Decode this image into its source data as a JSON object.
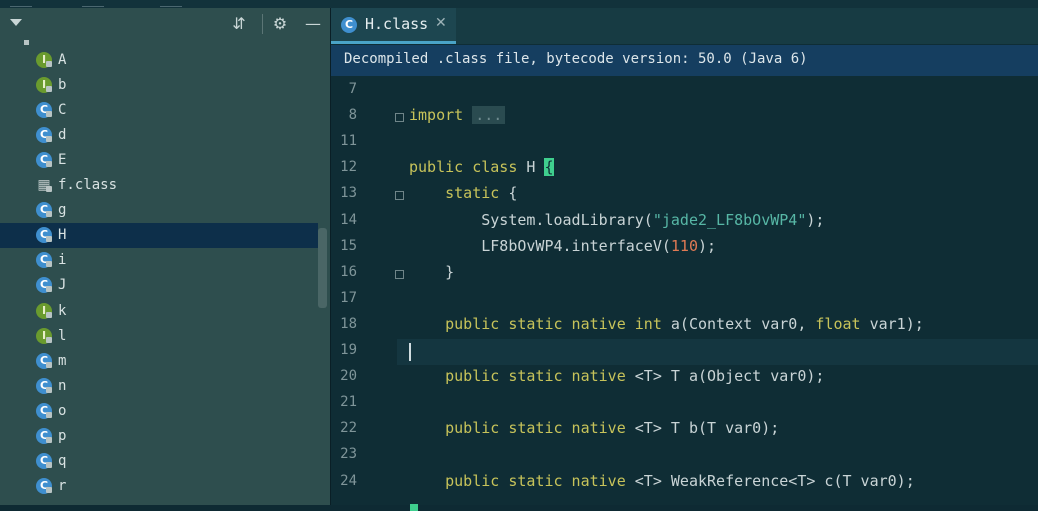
{
  "tree": {
    "items": [
      {
        "label": "A",
        "kind": "i",
        "icon": "interface-icon"
      },
      {
        "label": "b",
        "kind": "i",
        "icon": "interface-icon"
      },
      {
        "label": "C",
        "kind": "c",
        "icon": "class-icon"
      },
      {
        "label": "d",
        "kind": "c",
        "icon": "class-icon"
      },
      {
        "label": "E",
        "kind": "e",
        "icon": "enum-class-icon"
      },
      {
        "label": "f.class",
        "kind": "cls",
        "icon": "class-file-icon"
      },
      {
        "label": "g",
        "kind": "c",
        "icon": "class-icon"
      },
      {
        "label": "H",
        "kind": "c",
        "icon": "class-icon",
        "selected": true
      },
      {
        "label": "i",
        "kind": "e",
        "icon": "class-icon"
      },
      {
        "label": "J",
        "kind": "c",
        "icon": "class-icon"
      },
      {
        "label": "k",
        "kind": "i",
        "icon": "interface-icon"
      },
      {
        "label": "l",
        "kind": "i",
        "icon": "interface-icon"
      },
      {
        "label": "m",
        "kind": "c",
        "icon": "class-icon"
      },
      {
        "label": "n",
        "kind": "c",
        "icon": "class-icon"
      },
      {
        "label": "o",
        "kind": "c",
        "icon": "class-icon"
      },
      {
        "label": "p",
        "kind": "c",
        "icon": "class-icon"
      },
      {
        "label": "q",
        "kind": "c",
        "icon": "class-icon"
      },
      {
        "label": "r",
        "kind": "c",
        "icon": "class-icon"
      }
    ]
  },
  "tab": {
    "label": "H.class"
  },
  "banner": {
    "text": "Decompiled .class file, bytecode version: 50.0 (Java 6)"
  },
  "editor": {
    "current_line": "19",
    "lines": [
      {
        "n": "7",
        "segs": []
      },
      {
        "n": "8",
        "segs": [
          {
            "t": "import",
            "c": "kw"
          },
          {
            "t": " "
          },
          {
            "t": "...",
            "c": "ph"
          }
        ],
        "fold": true
      },
      {
        "n": "11",
        "segs": []
      },
      {
        "n": "12",
        "segs": [
          {
            "t": "public class",
            "c": "kw"
          },
          {
            "t": " H "
          },
          {
            "t": "{",
            "c": "brace"
          }
        ]
      },
      {
        "n": "13",
        "segs": [
          {
            "t": "    "
          },
          {
            "t": "static",
            "c": "kw"
          },
          {
            "t": " {"
          }
        ],
        "fold": true
      },
      {
        "n": "14",
        "segs": [
          {
            "t": "        System.loadLibrary("
          },
          {
            "t": "\"jade2_LF8bOvWP4\"",
            "c": "str"
          },
          {
            "t": ");"
          }
        ]
      },
      {
        "n": "15",
        "segs": [
          {
            "t": "        LF8bOvWP4.interfaceV("
          },
          {
            "t": "110",
            "c": "num"
          },
          {
            "t": ");"
          }
        ]
      },
      {
        "n": "16",
        "segs": [
          {
            "t": "    }"
          }
        ],
        "fold": true
      },
      {
        "n": "17",
        "segs": []
      },
      {
        "n": "18",
        "segs": [
          {
            "t": "    "
          },
          {
            "t": "public static native int",
            "c": "kw"
          },
          {
            "t": " a(Context var0, "
          },
          {
            "t": "float",
            "c": "kw"
          },
          {
            "t": " var1);"
          }
        ]
      },
      {
        "n": "19",
        "segs": []
      },
      {
        "n": "20",
        "segs": [
          {
            "t": "    "
          },
          {
            "t": "public static native",
            "c": "kw"
          },
          {
            "t": " <T> T a(Object var0);"
          }
        ]
      },
      {
        "n": "21",
        "segs": []
      },
      {
        "n": "22",
        "segs": [
          {
            "t": "    "
          },
          {
            "t": "public static native",
            "c": "kw"
          },
          {
            "t": " <T> T b(T var0);"
          }
        ]
      },
      {
        "n": "23",
        "segs": []
      },
      {
        "n": "24",
        "segs": [
          {
            "t": "    "
          },
          {
            "t": "public static native",
            "c": "kw"
          },
          {
            "t": " <T> WeakReference<T> c(T var0);"
          }
        ]
      }
    ]
  }
}
